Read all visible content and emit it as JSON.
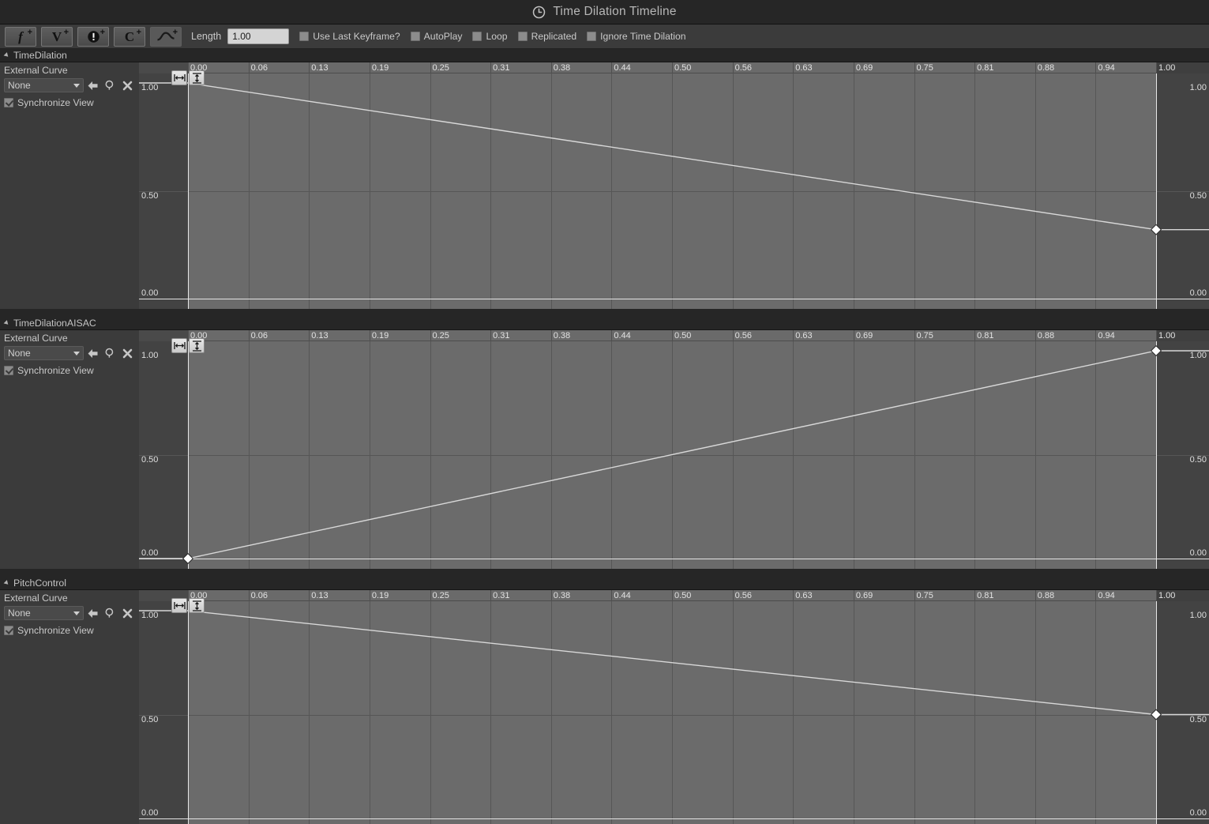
{
  "window": {
    "title": "Time Dilation Timeline",
    "icon": "clock-icon"
  },
  "toolbar": {
    "buttons": [
      {
        "name": "add-float-track-button",
        "glyph": "f",
        "plus": "+"
      },
      {
        "name": "add-vector-track-button",
        "glyph": "V",
        "plus": "+"
      },
      {
        "name": "add-event-track-button",
        "glyph": "!",
        "plus": "+"
      },
      {
        "name": "add-color-track-button",
        "glyph": "C",
        "plus": "+"
      },
      {
        "name": "add-external-curve-track-button",
        "glyph": "curve",
        "plus": "+"
      }
    ],
    "length_label": "Length",
    "length_value": "1.00",
    "checkboxes": [
      {
        "name": "use-last-keyframe-checkbox",
        "label": "Use Last Keyframe?",
        "checked": false
      },
      {
        "name": "autoplay-checkbox",
        "label": "AutoPlay",
        "checked": false
      },
      {
        "name": "loop-checkbox",
        "label": "Loop",
        "checked": false
      },
      {
        "name": "replicated-checkbox",
        "label": "Replicated",
        "checked": false
      },
      {
        "name": "ignore-time-dilation-checkbox",
        "label": "Ignore Time Dilation",
        "checked": false
      }
    ]
  },
  "common": {
    "external_curve_label": "External Curve",
    "external_curve_value": "None",
    "synchronize_view_label": "Synchronize View",
    "synchronize_view_checked": true,
    "axis_labels": [
      "1.00",
      "0.50",
      "0.00"
    ],
    "time_ticks": [
      "0.00",
      "0.06",
      "0.13",
      "0.19",
      "0.25",
      "0.31",
      "0.38",
      "0.44",
      "0.50",
      "0.56",
      "0.63",
      "0.69",
      "0.75",
      "0.81",
      "0.88",
      "0.94",
      "1.00"
    ]
  },
  "tracks": [
    {
      "name": "TimeDilation",
      "external_curve": "None",
      "synchronize_view": true,
      "chart_data": {
        "type": "line",
        "title": "TimeDilation",
        "xlabel": "",
        "ylabel": "",
        "xlim": [
          0,
          1
        ],
        "ylim": [
          0,
          1
        ],
        "grid": true,
        "x": [
          0.0,
          1.0
        ],
        "y": [
          1.0,
          0.32
        ],
        "keys": [
          {
            "time": 1.0,
            "value": 0.32,
            "selected": true
          }
        ],
        "xticks": [
          "0.00",
          "0.06",
          "0.13",
          "0.19",
          "0.25",
          "0.31",
          "0.38",
          "0.44",
          "0.50",
          "0.56",
          "0.63",
          "0.69",
          "0.75",
          "0.81",
          "0.88",
          "0.94",
          "1.00"
        ],
        "yticks": [
          "0.00",
          "0.50",
          "1.00"
        ]
      }
    },
    {
      "name": "TimeDilationAISAC",
      "external_curve": "None",
      "synchronize_view": true,
      "chart_data": {
        "type": "line",
        "title": "TimeDilationAISAC",
        "xlabel": "",
        "ylabel": "",
        "xlim": [
          0,
          1
        ],
        "ylim": [
          0,
          1
        ],
        "grid": true,
        "x": [
          0.0,
          1.0
        ],
        "y": [
          0.0,
          1.0
        ],
        "keys": [
          {
            "time": 0.0,
            "value": 0.0,
            "selected": true
          },
          {
            "time": 1.0,
            "value": 1.0,
            "selected": true
          }
        ],
        "xticks": [
          "0.00",
          "0.06",
          "0.13",
          "0.19",
          "0.25",
          "0.31",
          "0.38",
          "0.44",
          "0.50",
          "0.56",
          "0.63",
          "0.69",
          "0.75",
          "0.81",
          "0.88",
          "0.94",
          "1.00"
        ],
        "yticks": [
          "0.00",
          "0.50",
          "1.00"
        ]
      }
    },
    {
      "name": "PitchControl",
      "external_curve": "None",
      "synchronize_view": true,
      "chart_data": {
        "type": "line",
        "title": "PitchControl",
        "xlabel": "",
        "ylabel": "",
        "xlim": [
          0,
          1
        ],
        "ylim": [
          0,
          1
        ],
        "grid": true,
        "x": [
          0.0,
          1.0
        ],
        "y": [
          1.0,
          0.5
        ],
        "keys": [
          {
            "time": 1.0,
            "value": 0.5,
            "selected": true
          }
        ],
        "xticks": [
          "0.00",
          "0.06",
          "0.13",
          "0.19",
          "0.25",
          "0.31",
          "0.38",
          "0.44",
          "0.50",
          "0.56",
          "0.63",
          "0.69",
          "0.75",
          "0.81",
          "0.88",
          "0.94",
          "1.00"
        ],
        "yticks": [
          "0.00",
          "0.50",
          "1.00"
        ]
      }
    }
  ],
  "colors": {
    "window_bg": "#1d1d1d",
    "panel_bg": "#3b3b3b",
    "header_bg": "#262626",
    "plot_bg": "#434343",
    "range_fill": "#6b6b6b",
    "curve": "#d8d8d8",
    "text": "#c9c9c9"
  }
}
